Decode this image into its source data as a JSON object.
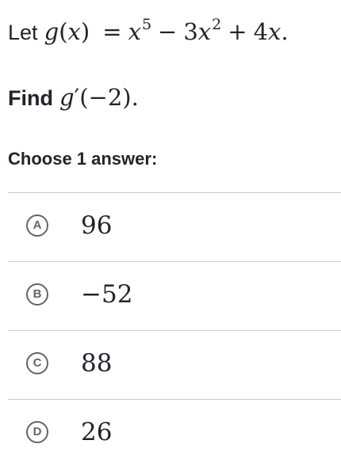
{
  "question": {
    "lead": "Let",
    "func_name": "g",
    "variable": "x",
    "equals": "=",
    "term1_base": "x",
    "term1_exp": "5",
    "minus": "−",
    "term2_coef": "3",
    "term2_base": "x",
    "term2_exp": "2",
    "plus": "+",
    "term3_coef": "4",
    "term3_base": "x",
    "end": ".",
    "find_label": "Find",
    "find_func": "g",
    "find_prime": "′",
    "find_arg": "−2",
    "find_end": "."
  },
  "prompt": "Choose 1 answer:",
  "choices": [
    {
      "letter": "A",
      "value": "96"
    },
    {
      "letter": "B",
      "value": "−52"
    },
    {
      "letter": "C",
      "value": "88"
    },
    {
      "letter": "D",
      "value": "26"
    }
  ],
  "colors": {
    "text": "#21242c",
    "badge": "#626569",
    "divider": "#c9cacc"
  }
}
